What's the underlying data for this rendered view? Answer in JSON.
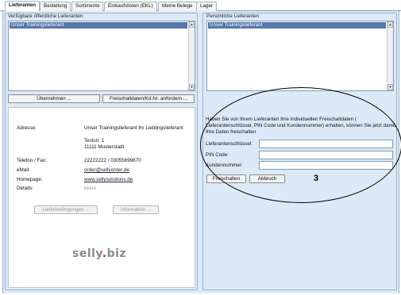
{
  "tabs": [
    {
      "label": "Lieferanten",
      "active": true
    },
    {
      "label": "Bestellung"
    },
    {
      "label": "Sortimente"
    },
    {
      "label": "Einkaufslisten (EKL)"
    },
    {
      "label": "Meine Belege"
    },
    {
      "label": "Lager"
    }
  ],
  "left": {
    "group_title": "Verfügbare öffentliche Lieferanten",
    "list_items": [
      "Unser Trainingslieferant"
    ],
    "btn_uebernehmen": "Übernehmen ...",
    "btn_freischalt": "Freischaltdaten/Kd.Nr. anfordern ...",
    "details": {
      "adresse_label": "Adresse:",
      "adresse_name": "Unser Trainingslieferant Ihr Lieblingslieferant",
      "adresse_street": "Teststr. 1",
      "adresse_city": "11111 Musterstadt",
      "telefon_label": "Telefon / Fax:",
      "telefon_value": "22222222 / 03055699670",
      "email_label": "eMail:",
      "email_value": "order@sellyorder.de",
      "homepage_label": "Homepage:",
      "homepage_value": "www.sellysolutions.de",
      "details_label": "Details:",
      "details_value": "keine",
      "btn_lieferbedingungen": "Lieferbedingungen ...",
      "btn_information": "Information ...",
      "logo_main": "selly",
      "logo_dot": ".",
      "logo_tld": "biz"
    }
  },
  "right": {
    "group_title": "Persönliche Lieferanten",
    "list_items": [
      "Unser Trainingslieferant"
    ],
    "info_text": "Haben Sie von Ihrem Lieferanten Ihre individuellen Freischaltdaten ( Lieferantenschlüssel, PIN Code und Kundennummer) erhalten, können Sie jetzt damit Ihre Daten freischalten",
    "fields": {
      "key_label": "Lieferantenschlüssel:",
      "key_value": "",
      "pin_label": "PIN Code:",
      "pin_value": "",
      "kunden_label": "Kundennummer:",
      "kunden_value": ""
    },
    "btn_freischalten": "Freischalten",
    "btn_abbruch": "Abbruch"
  },
  "annotation": "3",
  "colors": {
    "panel_bg": "#dde9f7",
    "selected_row": "#5577aa",
    "logo_dot": "#cc2222"
  }
}
